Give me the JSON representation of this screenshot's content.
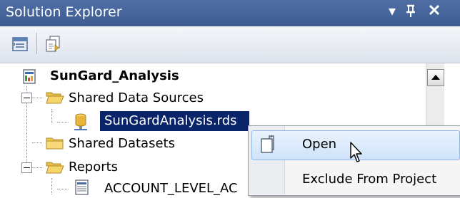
{
  "window": {
    "title": "Solution Explorer",
    "controls": {
      "dropdown": "▾",
      "pin": "ᚋ",
      "close": "✕"
    }
  },
  "toolbar": {
    "buttons": [
      {
        "icon": "properties-icon"
      },
      {
        "icon": "show-all-files-icon"
      }
    ]
  },
  "tree": {
    "project": {
      "label": "SunGard_Analysis",
      "icon": "report-project-icon"
    },
    "items": [
      {
        "label": "Shared Data Sources",
        "icon": "folder-open-icon",
        "expanded": true
      },
      {
        "label": "SunGardAnalysis.rds",
        "icon": "data-source-icon",
        "selected": true
      },
      {
        "label": "Shared Datasets",
        "icon": "folder-icon"
      },
      {
        "label": "Reports",
        "icon": "folder-open-icon",
        "expanded": true
      },
      {
        "label": "ACCOUNT_LEVEL_AC",
        "icon": "report-icon"
      }
    ],
    "expander_symbol": "−"
  },
  "context_menu": {
    "items": [
      {
        "label": "Open",
        "icon": "open-document-icon",
        "highlighted": true
      },
      {
        "label": "Exclude From Project"
      }
    ]
  },
  "colors": {
    "titlebar": "#3e5c92",
    "selection": "#0a246a",
    "menu_highlight": "#cfe3fb"
  }
}
